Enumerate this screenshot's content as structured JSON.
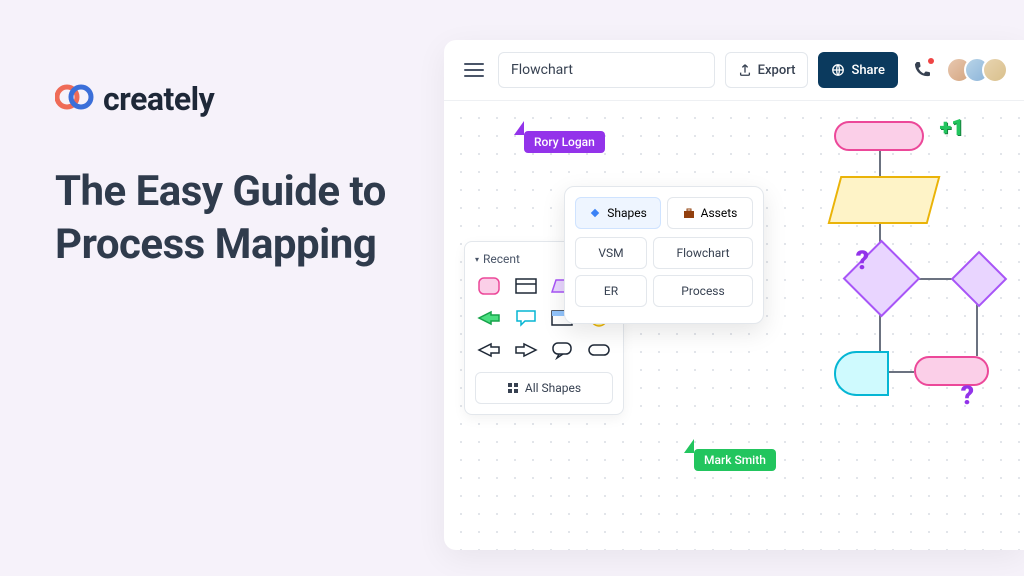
{
  "brand": "creately",
  "headline": "The Easy Guide to Process Mapping",
  "topbar": {
    "title": "Flowchart",
    "export_label": "Export",
    "share_label": "Share"
  },
  "cursors": {
    "user1": "Rory Logan",
    "user2": "Mark Smith"
  },
  "panel": {
    "recent_label": "Recent",
    "all_shapes_label": "All Shapes"
  },
  "popup": {
    "tabs": {
      "shapes": "Shapes",
      "assets": "Assets"
    },
    "chips": {
      "vsm": "VSM",
      "flowchart": "Flowchart",
      "er": "ER",
      "process": "Process"
    }
  },
  "decorations": {
    "plus_one": "+1",
    "q": "?"
  }
}
